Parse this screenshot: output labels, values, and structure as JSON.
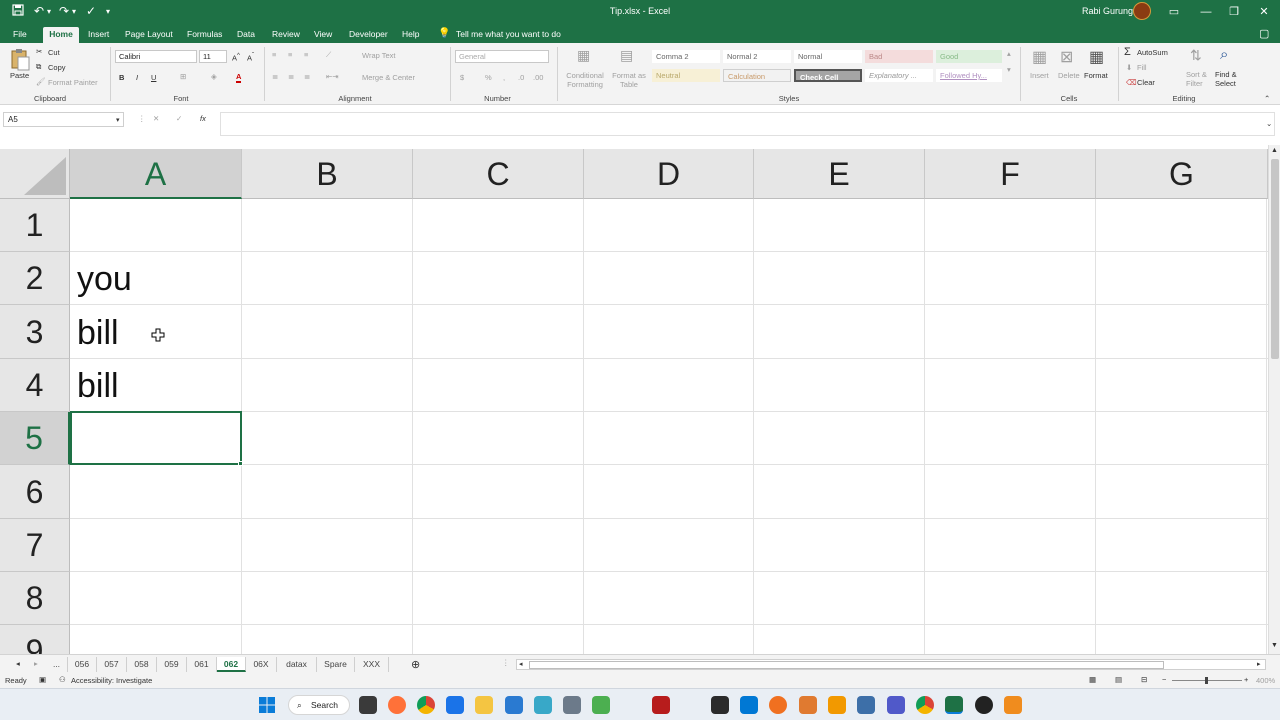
{
  "window": {
    "title": "Tip.xlsx  -  Excel",
    "user": "Rabi Gurung"
  },
  "ribbon_tabs": [
    "File",
    "Home",
    "Insert",
    "Page Layout",
    "Formulas",
    "Data",
    "Review",
    "View",
    "Developer",
    "Help"
  ],
  "tell_me": "Tell me what you want to do",
  "clipboard": {
    "paste": "Paste",
    "cut": "Cut",
    "copy": "Copy",
    "format_painter": "Format Painter",
    "label": "Clipboard"
  },
  "font": {
    "name": "Calibri",
    "size": "11",
    "bold": "B",
    "italic": "I",
    "underline": "U",
    "label": "Font"
  },
  "alignment": {
    "wrap": "Wrap Text",
    "merge": "Merge & Center",
    "label": "Alignment"
  },
  "number": {
    "format": "General",
    "currency": "$",
    "percent": "%",
    "label": "Number"
  },
  "styles": {
    "conditional": "Conditional Formatting",
    "format_as_table": "Format as Table",
    "row1": [
      "Comma 2",
      "Normal 2",
      "Normal",
      "Bad",
      "Good"
    ],
    "row2": [
      "Neutral",
      "Calculation",
      "Check Cell",
      "Explanatory ...",
      "Followed Hy..."
    ],
    "label": "Styles"
  },
  "cells": {
    "insert": "Insert",
    "delete": "Delete",
    "format": "Format",
    "label": "Cells"
  },
  "editing": {
    "autosum": "AutoSum",
    "fill": "Fill",
    "clear": "Clear",
    "sort": "Sort & Filter",
    "find": "Find & Select",
    "label": "Editing"
  },
  "formula_bar": {
    "name_box": "A5",
    "fx": "fx",
    "value": ""
  },
  "columns": [
    "A",
    "B",
    "C",
    "D",
    "E",
    "F",
    "G"
  ],
  "rows": [
    "1",
    "2",
    "3",
    "4",
    "5",
    "6",
    "7",
    "8",
    "9"
  ],
  "cell_values": {
    "A2": "you",
    "A3": "bill",
    "A4": "bill"
  },
  "sheets": [
    "...",
    "056",
    "057",
    "058",
    "059",
    "061",
    "062",
    "06X",
    "datax",
    "Spare",
    "XXX"
  ],
  "active_sheet": "062",
  "status": {
    "ready": "Ready",
    "accessibility": "Accessibility: Investigate",
    "zoom": "400%"
  },
  "taskbar": {
    "search": "Search"
  },
  "colors": {
    "accent": "#1e7145",
    "ribbon": "#f3f3f3",
    "header": "#e6e6e6"
  }
}
